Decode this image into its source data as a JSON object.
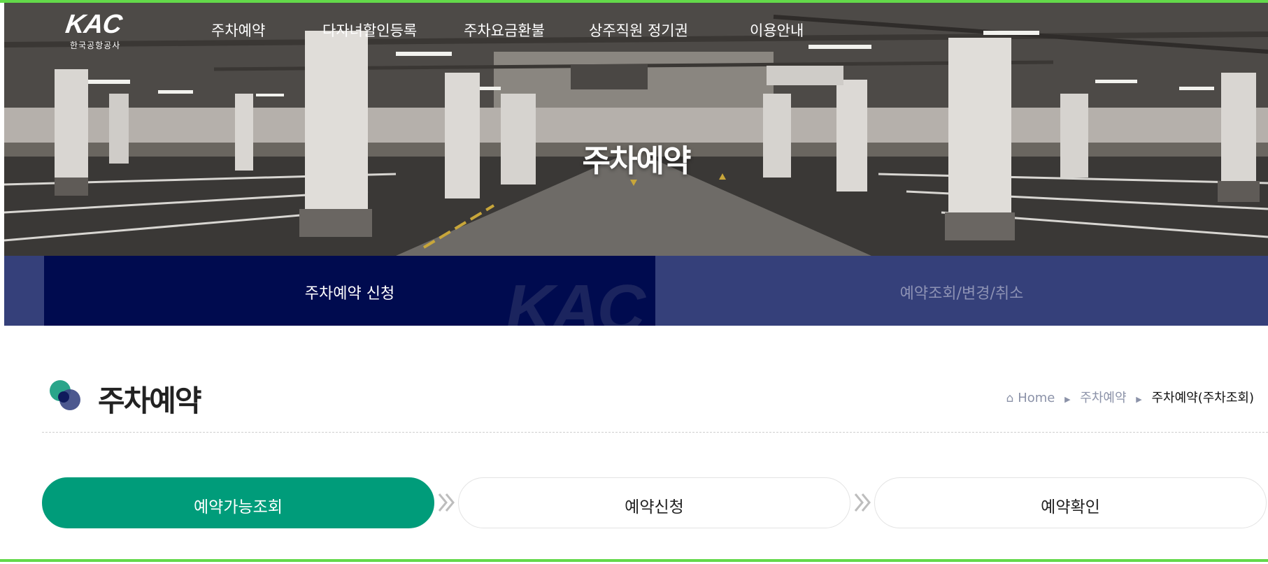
{
  "logo": {
    "mark": "KAC",
    "subtitle": "한국공항공사"
  },
  "nav": {
    "items": [
      "주차예약",
      "다자녀할인등록",
      "주차요금환불",
      "상주직원 정기권",
      "이용안내"
    ]
  },
  "hero": {
    "title": "주차예약"
  },
  "subtabs": {
    "active": "주차예약 신청",
    "inactive": "예약조회/변경/취소",
    "watermark": "KAC"
  },
  "page": {
    "title": "주차예약"
  },
  "breadcrumb": {
    "home": "Home",
    "section": "주차예약",
    "current": "주차예약(주차조회)"
  },
  "steps": [
    {
      "label": "예약가능조회",
      "state": "active"
    },
    {
      "label": "예약신청",
      "state": "inactive"
    },
    {
      "label": "예약확인",
      "state": "inactive"
    }
  ],
  "colors": {
    "frame_green": "#63d94a",
    "subtab_bg": "#35407a",
    "subtab_active_bg": "#000b4f",
    "step_active": "#009c7a"
  },
  "icons": {
    "breadcrumb_home": "home-icon",
    "breadcrumb_separator": "triangle-right-icon",
    "step_arrow": "double-chevron-right-icon",
    "page_icon": "overlapping-circles-icon"
  }
}
